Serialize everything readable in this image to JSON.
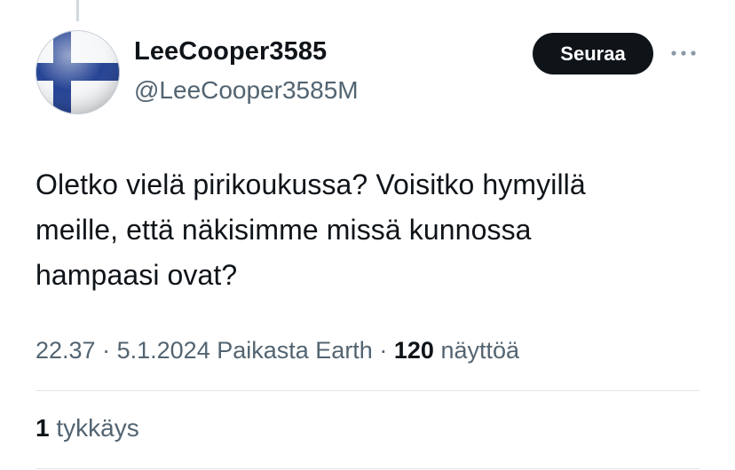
{
  "author": {
    "display_name": "LeeCooper3585",
    "handle": "@LeeCooper3585M",
    "avatar": "finland-flag-avatar"
  },
  "actions": {
    "follow_label": "Seuraa",
    "more_icon": "more-horizontal-icon"
  },
  "tweet": {
    "text": "Oletko vielä pirikoukussa? Voisitko hymyillä\nmeille, että näkisimme missä kunnossa\nhampaasi ovat?"
  },
  "meta": {
    "time": "22.37",
    "separator": "·",
    "date": "5.1.2024",
    "source": "Paikasta Earth",
    "views_count": "120",
    "views_label": "näyttöä"
  },
  "engagement": {
    "likes_count": "1",
    "likes_label": "tykkäys"
  },
  "colors": {
    "text": "#0f1419",
    "secondary_text": "#536471",
    "button_bg": "#0f1419",
    "divider": "#e1e8ed",
    "flag_blue": "#1a3a8f"
  }
}
